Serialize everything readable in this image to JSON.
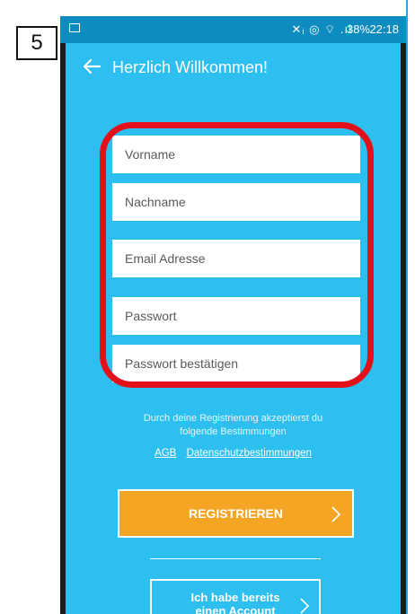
{
  "step_number": "5",
  "status_bar": {
    "icons": "✕ᵢ ◎ ⌔ .ıl",
    "battery": "38%",
    "time": "22:18"
  },
  "app_bar": {
    "title": "Herzlich Willkommen!"
  },
  "form": {
    "first_name_placeholder": "Vorname",
    "last_name_placeholder": "Nachname",
    "email_placeholder": "Email Adresse",
    "password_placeholder": "Passwort",
    "password_confirm_placeholder": "Passwort bestätigen"
  },
  "terms": {
    "line1": "Durch deine Registrierung akzeptierst du",
    "line2": "folgende Bestimmungen",
    "agb_link": "AGB",
    "privacy_link": "Datenschutzbestimmungen"
  },
  "buttons": {
    "register": "REGISTRIEREN",
    "account_line1": "Ich habe bereits",
    "account_line2": "einen Account"
  },
  "colors": {
    "screen_bg": "#2dbff0",
    "status_bar": "#0e8bbf",
    "register_button": "#f5a524",
    "highlight": "#e3101b"
  }
}
